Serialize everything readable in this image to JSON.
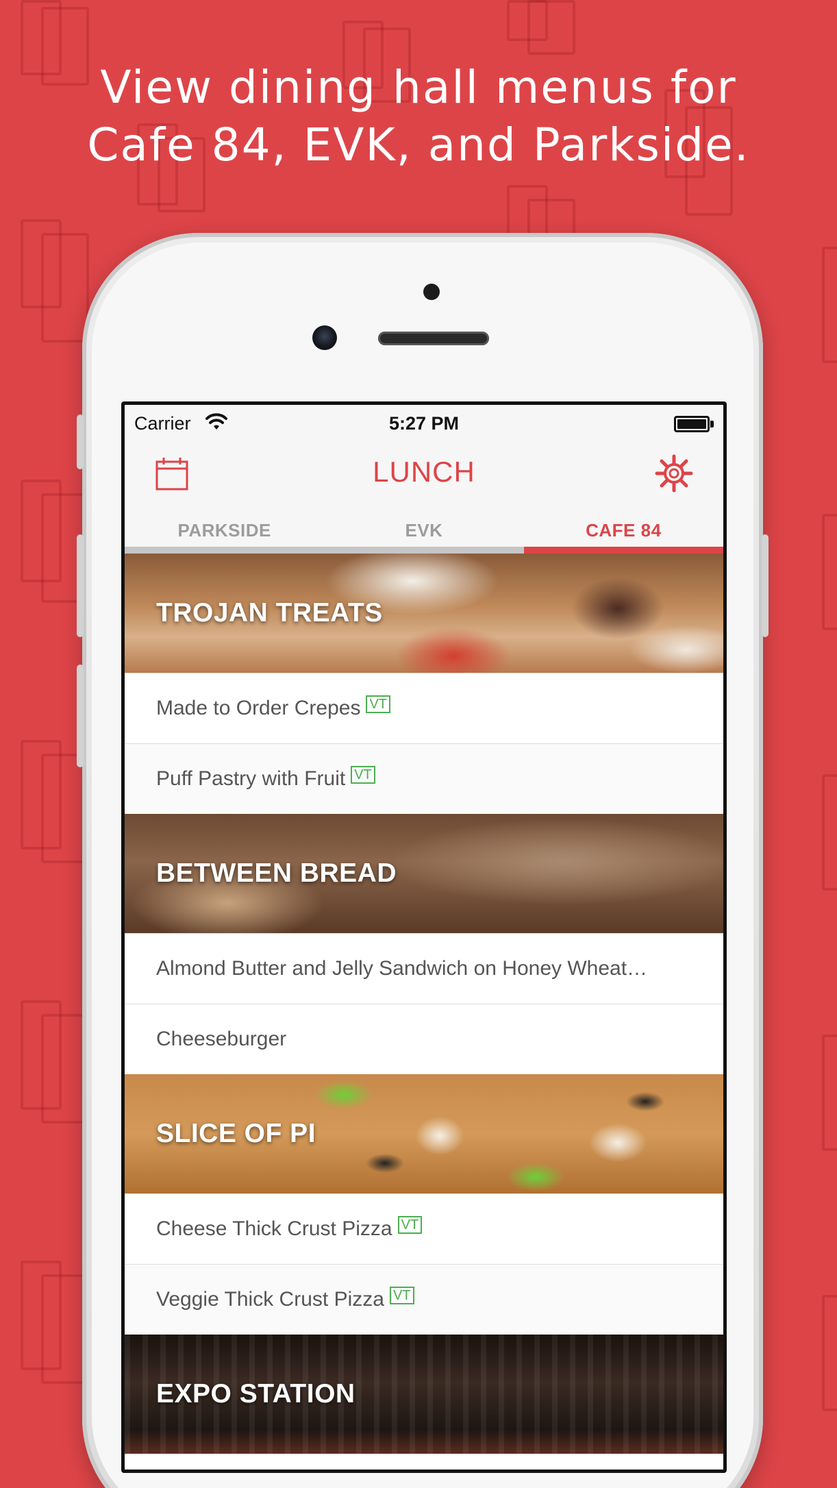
{
  "headline": {
    "line1": "View dining hall menus for",
    "line2": "Cafe 84, EVK, and Parkside."
  },
  "status_bar": {
    "carrier": "Carrier",
    "time": "5:27 PM",
    "icons": [
      "wifi-icon",
      "battery-icon"
    ]
  },
  "nav_bar": {
    "title": "LUNCH",
    "left_icon": "calendar-icon",
    "right_icon": "gear-icon"
  },
  "tabs": [
    {
      "label": "PARKSIDE",
      "selected": false
    },
    {
      "label": "EVK",
      "selected": false
    },
    {
      "label": "CAFE 84",
      "selected": true
    }
  ],
  "sections": [
    {
      "title": "TROJAN TREATS",
      "items": [
        {
          "name": "Made to Order Crepes",
          "tag": "VT"
        },
        {
          "name": "Puff Pastry with Fruit",
          "tag": "VT"
        }
      ]
    },
    {
      "title": "BETWEEN BREAD",
      "items": [
        {
          "name": "Almond Butter and Jelly Sandwich on Honey Wheat…",
          "tag": ""
        },
        {
          "name": "Cheeseburger",
          "tag": ""
        }
      ]
    },
    {
      "title": "SLICE OF PI",
      "items": [
        {
          "name": "Cheese Thick Crust Pizza",
          "tag": "VT"
        },
        {
          "name": "Veggie Thick Crust Pizza",
          "tag": "VT"
        }
      ]
    },
    {
      "title": "EXPO STATION",
      "items": []
    }
  ],
  "colors": {
    "brand_red": "#dd4448",
    "vegetarian_green": "#4caf50"
  }
}
